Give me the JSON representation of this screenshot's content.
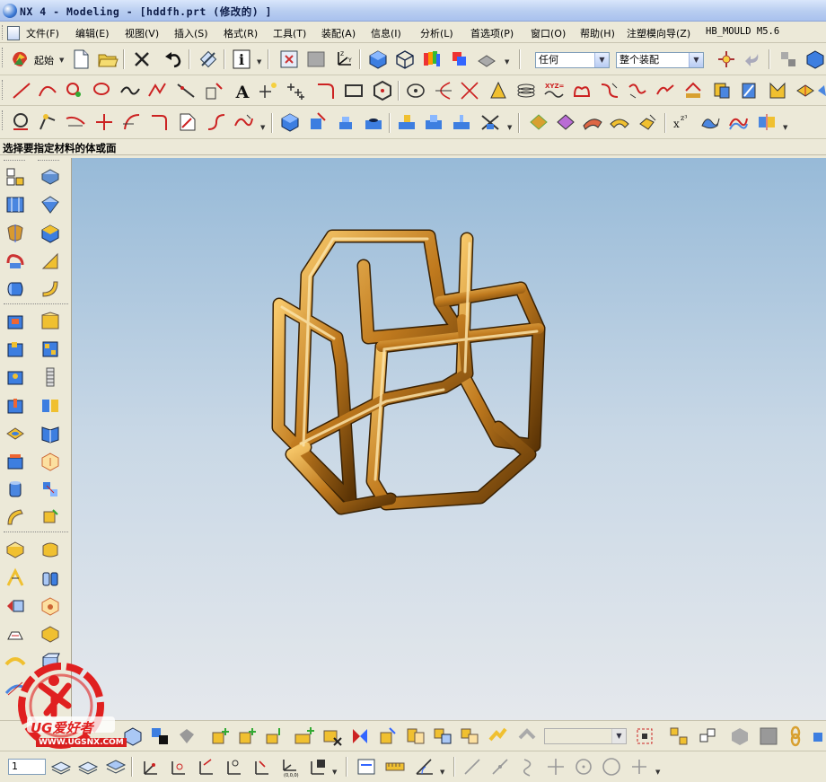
{
  "window": {
    "title": "NX 4 - Modeling - [hddfh.prt  (修改的) ]"
  },
  "menubar": {
    "items": [
      "文件(F)",
      "编辑(E)",
      "视图(V)",
      "插入(S)",
      "格式(R)",
      "工具(T)",
      "装配(A)",
      "信息(I)",
      "分析(L)",
      "首选项(P)",
      "窗口(O)",
      "帮助(H)",
      "注塑模向导(Z)",
      "HB_MOULD M5.6"
    ]
  },
  "standard_toolbar": {
    "start_label": "起始",
    "filter_select": "任何",
    "scope_select": "整个装配"
  },
  "cue_line": {
    "text": "选择要指定材料的体或面"
  },
  "bottom_toolbar": {
    "layer_value": "1"
  },
  "watermark": {
    "brand": "UG爱好者",
    "url": "WWW.UGSNX.COM"
  },
  "colors": {
    "tube": "#c07a1e",
    "viewport_top": "#97bad8",
    "viewport_bottom": "#e5e8ec",
    "chrome": "#ece9d8",
    "accent_red": "#e02020"
  }
}
